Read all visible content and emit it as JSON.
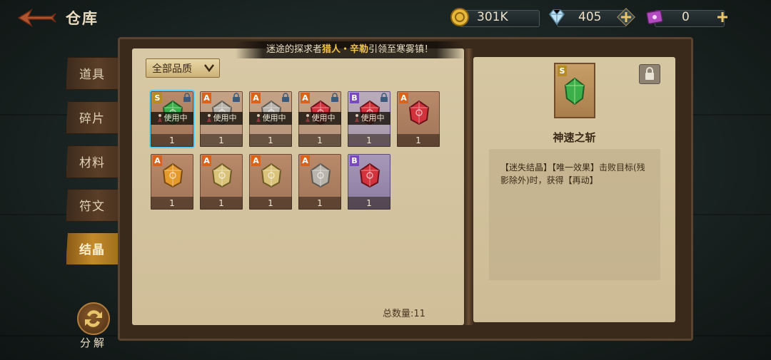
{
  "header": {
    "title": "仓库"
  },
  "resources": [
    {
      "icon": "gold-coin-icon",
      "value": "301K",
      "has_plus": false
    },
    {
      "icon": "diamond-icon",
      "value": "405",
      "has_plus": true
    },
    {
      "icon": "purple-ticket-icon",
      "value": "0",
      "has_plus": true
    }
  ],
  "sidebar": {
    "tabs": [
      {
        "label": "道具",
        "active": false
      },
      {
        "label": "碎片",
        "active": false
      },
      {
        "label": "材料",
        "active": false
      },
      {
        "label": "符文",
        "active": false
      },
      {
        "label": "结晶",
        "active": true
      }
    ]
  },
  "notice": {
    "prefix": "迷途的探求者",
    "highlight": "猎人・辛勒",
    "suffix": "引领至寒雾镇！"
  },
  "filter": {
    "label": "全部品质"
  },
  "items": [
    {
      "grade": "S",
      "gem": "green",
      "in_use": true,
      "use_label": "使用中",
      "count": "1",
      "selected": true
    },
    {
      "grade": "A",
      "gem": "silver",
      "in_use": true,
      "use_label": "使用中",
      "count": "1"
    },
    {
      "grade": "A",
      "gem": "silver",
      "in_use": true,
      "use_label": "使用中",
      "count": "1"
    },
    {
      "grade": "A",
      "gem": "red",
      "in_use": true,
      "use_label": "使用中",
      "count": "1"
    },
    {
      "grade": "B",
      "gem": "red",
      "in_use": true,
      "use_label": "使用中",
      "count": "1"
    },
    {
      "grade": "A",
      "gem": "red",
      "in_use": false,
      "count": "1"
    },
    {
      "grade": "A",
      "gem": "orange",
      "in_use": false,
      "count": "1"
    },
    {
      "grade": "A",
      "gem": "gold",
      "in_use": false,
      "count": "1"
    },
    {
      "grade": "A",
      "gem": "gold",
      "in_use": false,
      "count": "1"
    },
    {
      "grade": "A",
      "gem": "silver",
      "in_use": false,
      "count": "1"
    },
    {
      "grade": "B",
      "gem": "red",
      "in_use": false,
      "count": "1"
    }
  ],
  "total": {
    "label": "总数量:11"
  },
  "detail": {
    "grade": "S",
    "name": "神速之斩",
    "description": "【迷失结晶】【唯一效果】击败目标(残影除外)时，获得【再动】"
  },
  "decompose": {
    "label": "分解"
  },
  "colors": {
    "selected_outline": "#4fd2ff",
    "grade_A": "#d7641e",
    "grade_B": "#7a4bb8",
    "grade_S": "#b68a25",
    "highlight_text": "#f0c24a"
  }
}
